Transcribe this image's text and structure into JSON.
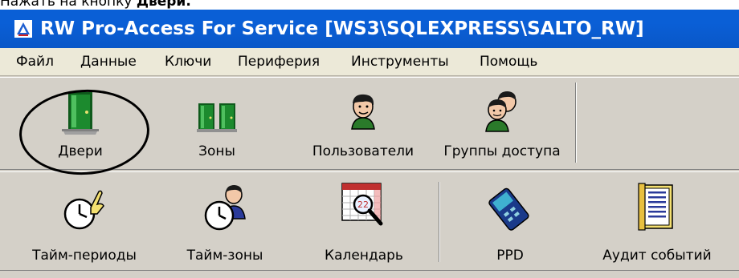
{
  "caption": {
    "prefix": "Нажать на кнопку ",
    "bold": "Двери."
  },
  "window": {
    "title": "RW Pro-Access For Service [WS3\\SQLEXPRESS\\SALTO_RW]"
  },
  "menu": [
    "Файл",
    "Данные",
    "Ключи",
    "Периферия",
    "Инструменты",
    "Помощь"
  ],
  "toolbar1": [
    {
      "label": "Двери",
      "icon": "door-icon"
    },
    {
      "label": "Зоны",
      "icon": "zones-icon"
    },
    {
      "label": "Пользователи",
      "icon": "user-icon"
    },
    {
      "label": "Группы доступа",
      "icon": "user-group-icon"
    }
  ],
  "toolbar2": [
    {
      "label": "Тайм-периоды",
      "icon": "clock-hand-icon"
    },
    {
      "label": "Тайм-зоны",
      "icon": "clock-user-icon"
    },
    {
      "label": "Календарь",
      "icon": "calendar-icon"
    },
    {
      "label": "PPD",
      "icon": "ppd-device-icon"
    },
    {
      "label": "Аудит событий",
      "icon": "audit-log-icon"
    }
  ],
  "colors": {
    "titlebar": "#0a5fd6",
    "door": "#1c8a2e",
    "highlight": "#000000"
  }
}
